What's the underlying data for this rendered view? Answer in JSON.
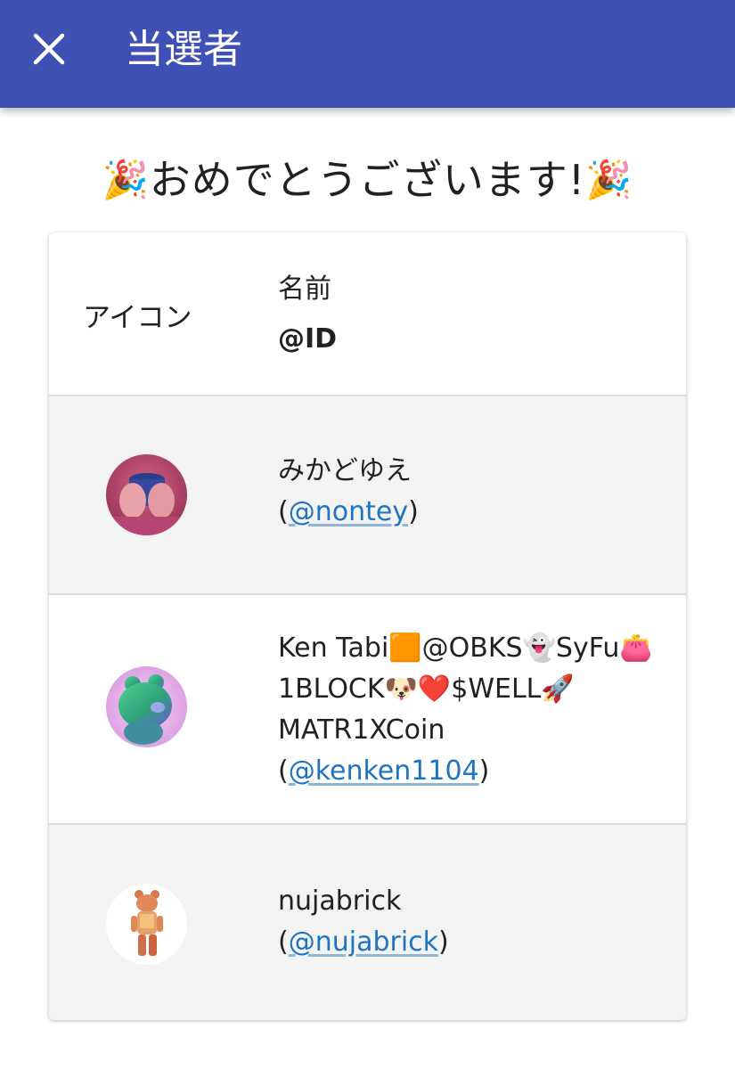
{
  "appbar": {
    "title": "当選者",
    "close_icon": "close-icon",
    "color": "#3f51b5"
  },
  "congrats": {
    "text": "おめでとうございます!",
    "emoji": "🎉"
  },
  "table": {
    "header": {
      "icon_label": "アイコン",
      "name_label": "名前",
      "id_label": "@ID"
    },
    "rows": [
      {
        "name": "みかどゆえ",
        "handle": "@nontey",
        "avatar": "avatar-hands-holding-cup"
      },
      {
        "name": "Ken Tabi🟧@OBKS👻SyFu👛1BLOCK🐶❤️$WELL🚀MATR1XCoin",
        "handle": "@kenken1104",
        "avatar": "avatar-green-3d-bear"
      },
      {
        "name": "nujabrick",
        "handle": "@nujabrick",
        "avatar": "avatar-bearbrick-figure"
      }
    ]
  },
  "colors": {
    "link": "#1e73c3",
    "row_shade": "#f3f3f3"
  }
}
